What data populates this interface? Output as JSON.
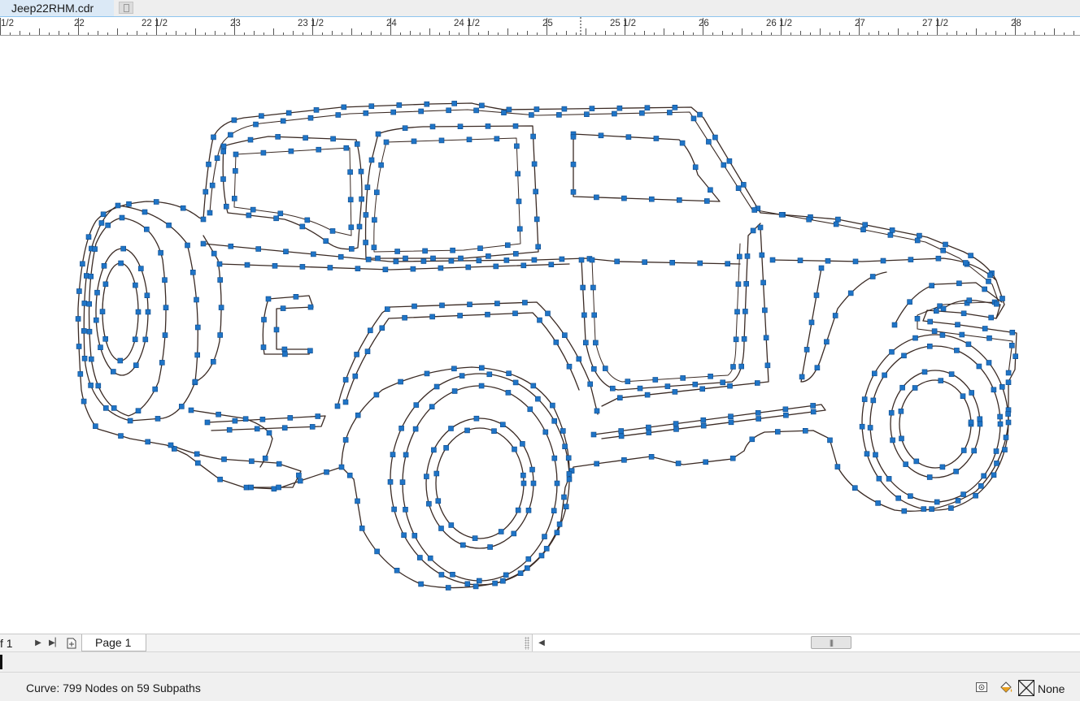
{
  "document_tab": {
    "title": "Jeep22RHM.cdr"
  },
  "ruler": {
    "labels": [
      "1/2",
      "22",
      "22 1/2",
      "23",
      "23 1/2",
      "24",
      "24 1/2",
      "25",
      "25 1/2",
      "26",
      "26 1/2",
      "27",
      "27 1/2",
      "28"
    ]
  },
  "page_nav": {
    "page_count": "f 1",
    "page_tab": "Page 1"
  },
  "status": {
    "selection_info": "Curve: 799 Nodes on 59 Subpaths",
    "fill_value": "None"
  },
  "icons": {
    "ruler_icon": "ruler",
    "first_page": "triangle-right",
    "last_page": "skip-end",
    "add_page": "page-add",
    "scroll_left": "triangle-left",
    "scroll_thumb_grip": "grip-lines",
    "snap_icon": "camera-icon",
    "fill_icon": "paint-bucket-icon",
    "no_fill_swatch": "x-box-icon"
  },
  "colors": {
    "outline": "#3a2a24",
    "node": "#1f74c6",
    "tab_highlight": "#dbe9f6",
    "ruler_marker": "#8ec4ee"
  }
}
